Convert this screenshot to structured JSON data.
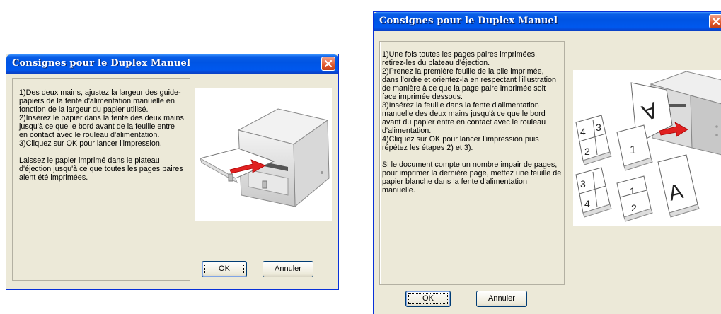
{
  "dialog_left": {
    "title": "Consignes pour le Duplex Manuel",
    "instructions": "1)Des deux mains, ajustez la largeur des guide-papiers de la fente d'alimentation manuelle en fonction de la largeur du papier utilisé.\n2)Insérez le papier dans la fente des deux mains jusqu'à ce que le bord avant de la feuille entre en contact avec le rouleau d'alimentation.\n3)Cliquez sur OK pour lancer l'impression.\n\nLaissez le papier imprimé dans le plateau d'éjection jusqu'à ce que toutes les pages paires aient été imprimées.",
    "ok_label": "OK",
    "cancel_label": "Annuler"
  },
  "dialog_right": {
    "title": "Consignes pour le Duplex Manuel",
    "instructions": "1)Une fois toutes les pages paires imprimées, retirez-les du plateau d'éjection.\n2)Prenez la première feuille de la pile imprimée, dans l'ordre et orientez-la en respectant l'illustration de manière à ce que la page paire imprimée soit face imprimée dessous.\n3)Insérez la feuille dans la fente d'alimentation manuelle des deux mains jusqu'à ce que le bord avant du papier entre en contact avec le rouleau d'alimentation.\n4)Cliquez sur OK pour lancer l'impression puis répétez les étapes 2) et 3).\n\n Si le document compte un nombre impair de pages, pour imprimer la dernière page, mettez une feuille de papier blanche dans la fente d'alimentation manuelle.",
    "ok_label": "OK",
    "cancel_label": "Annuler"
  },
  "illustration_right": {
    "page_labels": [
      "4",
      "3",
      "2",
      "1",
      "3",
      "4",
      "1",
      "2",
      "A",
      "A"
    ]
  },
  "colors": {
    "titlebar": "#0054e3",
    "dialog_bg": "#ece9d8",
    "close_button": "#e35a2e",
    "arrow": "#e02020"
  }
}
